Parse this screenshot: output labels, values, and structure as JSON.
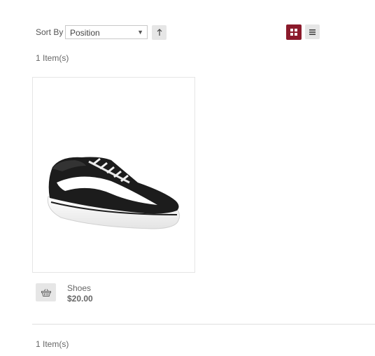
{
  "toolbar": {
    "sort_label": "Sort By",
    "sort_selected": "Position",
    "sort_direction_icon": "arrow-up-icon",
    "view_grid_icon": "grid-icon",
    "view_list_icon": "list-icon",
    "active_view": "grid",
    "accent_color": "#8b1a2b"
  },
  "results": {
    "count_top": "1 Item(s)",
    "count_bottom": "1 Item(s)"
  },
  "products": [
    {
      "name": "Shoes",
      "price": "$20.00",
      "image": "black-low-top-sneaker",
      "cart_icon": "basket-icon"
    }
  ]
}
